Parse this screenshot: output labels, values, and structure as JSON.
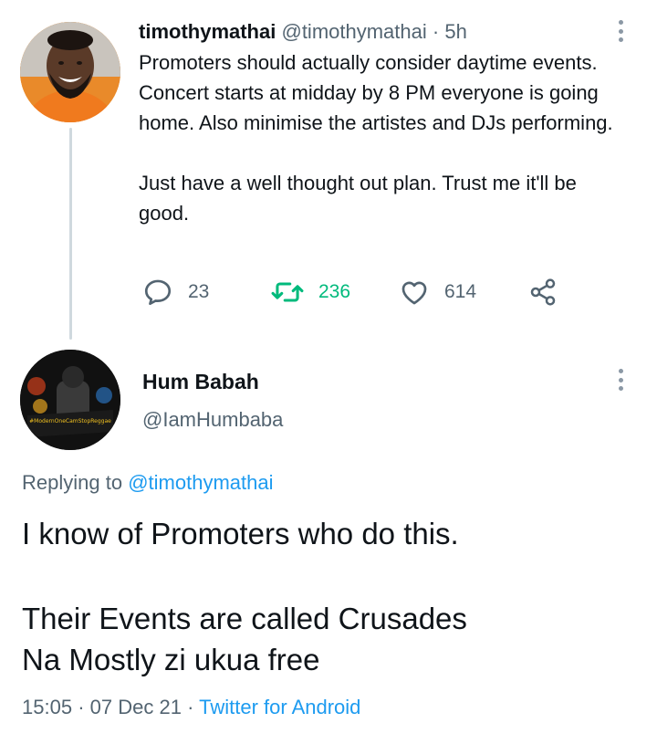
{
  "thread": {
    "original_tweet": {
      "display_name": "timothymathai",
      "handle": "@timothymathai",
      "separator": "·",
      "time_ago": "5h",
      "paragraphs": [
        "Promoters should actually consider daytime events. Concert starts at midday by 8 PM everyone is going home. Also minimise the artistes and DJs performing.",
        "Just have a well thought out plan. Trust me it'll be good."
      ],
      "actions": {
        "replies": "23",
        "retweets": "236",
        "likes": "614"
      },
      "icons": [
        "reply-icon",
        "retweet-icon",
        "like-icon",
        "share-icon",
        "more-icon"
      ]
    },
    "reply_tweet": {
      "display_name": "Hum Babah",
      "handle": "@IamHumbaba",
      "replying_prefix": "Replying to",
      "replying_to": "@timothymathai",
      "lines": [
        "I know of Promoters who do this.",
        "",
        "Their Events are called Crusades",
        "Na Mostly zi ukua free"
      ],
      "time": "15:05",
      "date": "07 Dec 21",
      "separator": "·",
      "client": "Twitter for Android",
      "avatar_caption": "#ModernOneCamStopReggae"
    }
  },
  "colors": {
    "text": "#0f1419",
    "secondary": "#536471",
    "link": "#1d9bf0",
    "retweet": "#00ba7c",
    "thread_line": "#cfd9de",
    "avatar1_bg": "#f28c28"
  }
}
